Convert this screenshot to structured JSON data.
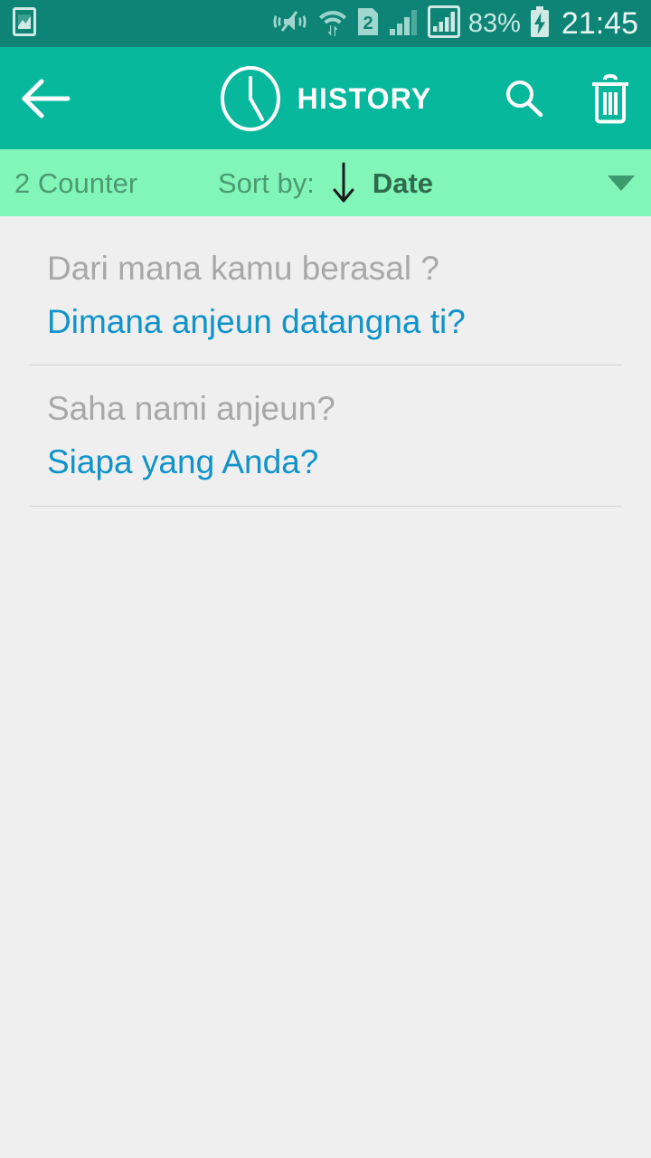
{
  "status_bar": {
    "icons": [
      "gallery-image-icon",
      "vibrate-mute-icon",
      "wifi-data-icon",
      "sim2-icon",
      "signal-bars-icon",
      "signal-bars-boxed-icon"
    ],
    "battery_percent": "83%",
    "battery_state": "charging",
    "clock": "21:45",
    "background_color": "#0d8476"
  },
  "toolbar": {
    "back_label": "back-arrow",
    "clock_icon": "clock-icon",
    "title": "HISTORY",
    "search_label": "search-icon",
    "delete_label": "delete-icon",
    "background_color": "#07b89c"
  },
  "sort_bar": {
    "counter": "2 Counter",
    "sort_by_label": "Sort by:",
    "sort_direction_icon": "arrow-down-icon",
    "sort_value": "Date",
    "dropdown_icon": "chevron-down-icon",
    "background_color": "#82f5b9",
    "text_color": "#4b9a72"
  },
  "history": {
    "items": [
      {
        "source": "Dari mana kamu berasal ?",
        "translation": "Dimana anjeun datangna ti?"
      },
      {
        "source": "Saha nami anjeun?",
        "translation": "Siapa yang Anda?"
      }
    ],
    "source_color": "#a8a8a8",
    "translation_color": "#0f93ca",
    "background_color": "#efefef"
  }
}
